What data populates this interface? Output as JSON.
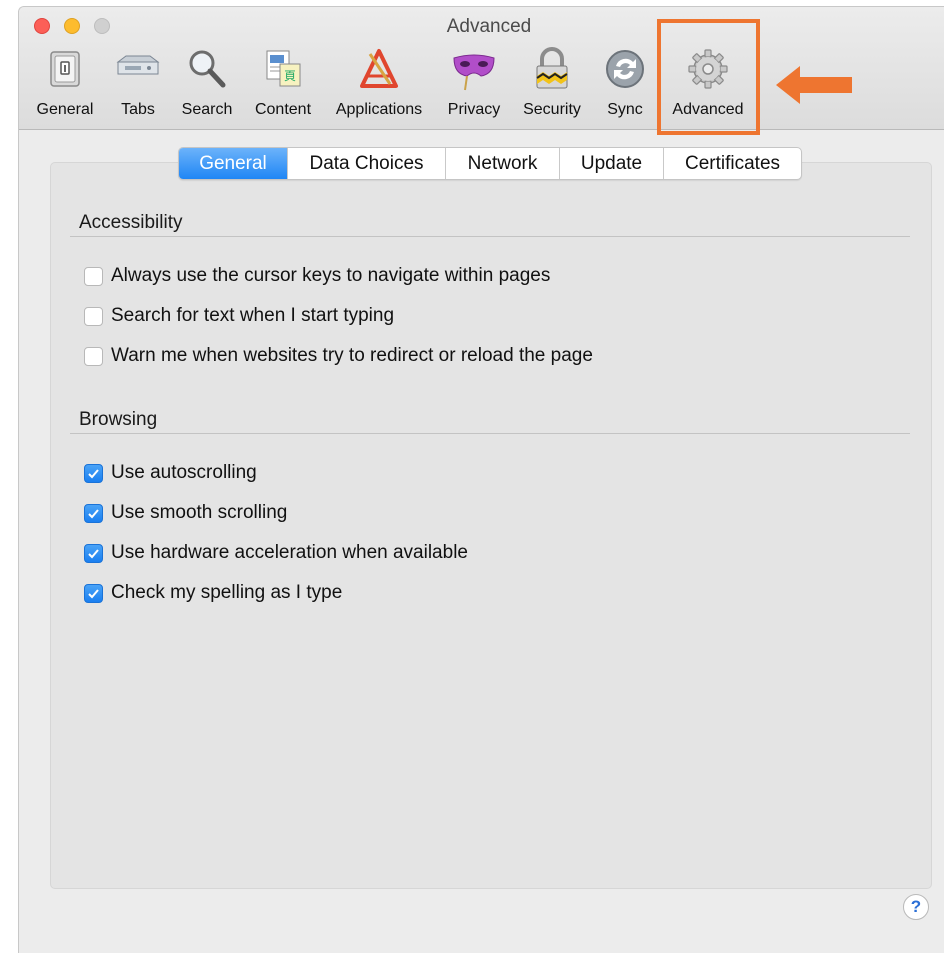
{
  "window": {
    "title": "Advanced"
  },
  "toolbar": {
    "items": [
      {
        "label": "General",
        "icon": "switch-icon"
      },
      {
        "label": "Tabs",
        "icon": "tabs-icon"
      },
      {
        "label": "Search",
        "icon": "magnifier-icon"
      },
      {
        "label": "Content",
        "icon": "content-icon"
      },
      {
        "label": "Applications",
        "icon": "applications-icon"
      },
      {
        "label": "Privacy",
        "icon": "mask-icon"
      },
      {
        "label": "Security",
        "icon": "padlock-icon"
      },
      {
        "label": "Sync",
        "icon": "sync-icon"
      },
      {
        "label": "Advanced",
        "icon": "gear-icon"
      }
    ],
    "selected": "Advanced"
  },
  "annotation": {
    "highlight_color": "#ee7530"
  },
  "tabs": {
    "items": [
      "General",
      "Data Choices",
      "Network",
      "Update",
      "Certificates"
    ],
    "active": "General",
    "active_color": "#1f86f5"
  },
  "accessibility": {
    "title": "Accessibility",
    "options": [
      {
        "label": "Always use the cursor keys to navigate within pages",
        "checked": false
      },
      {
        "label": "Search for text when I start typing",
        "checked": false
      },
      {
        "label": "Warn me when websites try to redirect or reload the page",
        "checked": false
      }
    ]
  },
  "browsing": {
    "title": "Browsing",
    "options": [
      {
        "label": "Use autoscrolling",
        "checked": true
      },
      {
        "label": "Use smooth scrolling",
        "checked": true
      },
      {
        "label": "Use hardware acceleration when available",
        "checked": true
      },
      {
        "label": "Check my spelling as I type",
        "checked": true
      }
    ]
  },
  "help": {
    "label": "?"
  }
}
